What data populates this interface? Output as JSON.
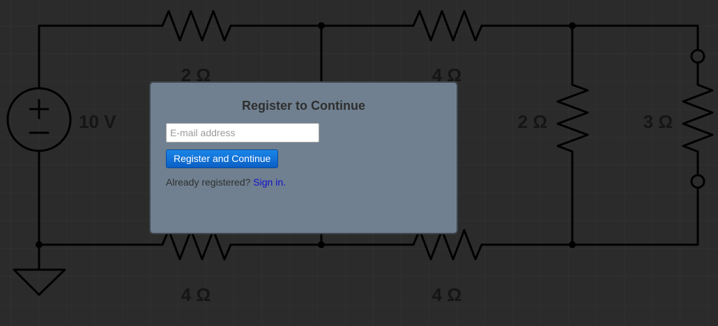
{
  "circuit": {
    "source_label": "10 V",
    "resistors": {
      "top_left": "2 Ω",
      "top_right": "4 Ω",
      "middle_vertical": "2 Ω",
      "right_vertical": "3 Ω",
      "bottom_left": "4 Ω",
      "bottom_right": "4 Ω"
    }
  },
  "dialog": {
    "title": "Register to Continue",
    "email_placeholder": "E-mail address",
    "email_value": "",
    "register_button_label": "Register and Continue",
    "already_registered_text": "Already registered?",
    "sign_in_link": "Sign in."
  }
}
